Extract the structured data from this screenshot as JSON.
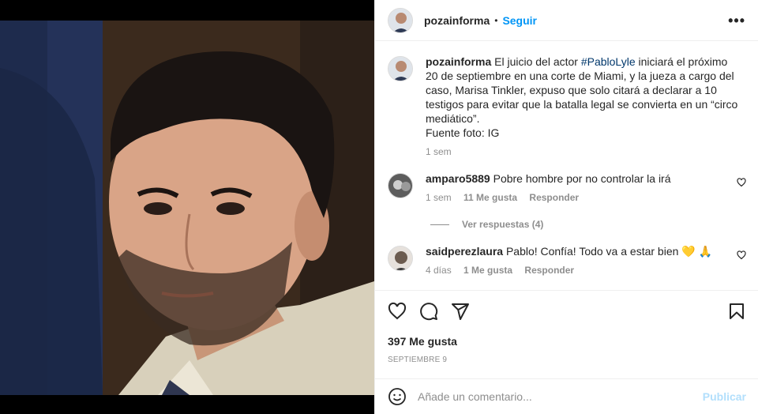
{
  "post": {
    "username": "pozainforma",
    "separator": "•",
    "follow_label": "Seguir",
    "more_label": "•••",
    "image_icon": "portrait-photo"
  },
  "caption": {
    "username": "pozainforma",
    "text_before": "El juicio del actor ",
    "hashtag": "#PabloLyle",
    "text_after": " iniciará el próximo 20 de septiembre en una corte de Miami, y la jueza a cargo del caso, Marisa Tinkler, expuso que solo citará a declarar a 10 testigos para evitar que la batalla legal se convierta en un “circo mediático”.",
    "source": "Fuente foto: IG",
    "time": "1 sem"
  },
  "comments": [
    {
      "username": "amparo5889",
      "text": "Pobre hombre por no controlar la irá",
      "time": "1 sem",
      "likes": "11 Me gusta",
      "reply": "Responder",
      "view_replies": "Ver respuestas (4)"
    },
    {
      "username": "saidperezlaura",
      "text": "Pablo! Confía! Todo va a estar bien 💛 🙏",
      "time": "4 días",
      "likes": "1 Me gusta",
      "reply": "Responder"
    }
  ],
  "actions": {
    "like_icon": "heart-icon",
    "comment_icon": "comment-icon",
    "share_icon": "paper-plane-icon",
    "save_icon": "bookmark-icon",
    "likes_count": "397 Me gusta",
    "date": "SEPTIEMBRE 9"
  },
  "add_comment": {
    "placeholder": "Añade un comentario...",
    "publish": "Publicar",
    "emoji_icon": "smiley-icon"
  },
  "colors": {
    "accent": "#0095f6",
    "publish_disabled": "#b2dffc",
    "muted": "#8e8e8e",
    "hashtag": "#00376b"
  }
}
